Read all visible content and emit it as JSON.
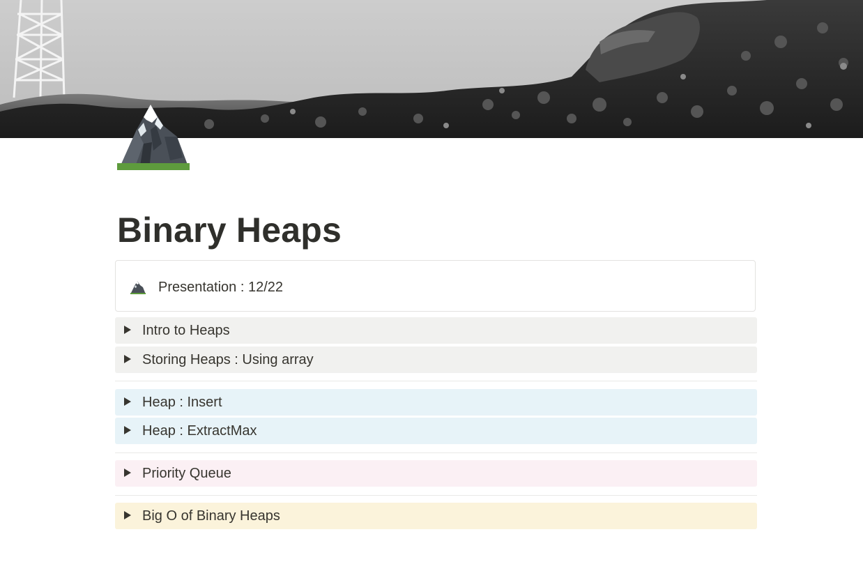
{
  "page": {
    "title": "Binary Heaps",
    "icon": "mountain-icon"
  },
  "callout": {
    "icon": "mountain-icon",
    "text": "Presentation : 12/22"
  },
  "toggles": [
    {
      "label": "Intro to Heaps",
      "color": "#f1f1ef"
    },
    {
      "label": "Storing Heaps : Using array",
      "color": "#f1f1ef"
    },
    {
      "label": "Heap : Insert",
      "color": "#e7f3f8"
    },
    {
      "label": "Heap : ExtractMax",
      "color": "#e7f3f8"
    },
    {
      "label": "Priority Queue",
      "color": "#fbf0f4"
    },
    {
      "label": "Big O of Binary Heaps",
      "color": "#fbf3db"
    }
  ],
  "colors": {
    "gray_block": "#f1f1ef",
    "blue_block": "#e7f3f8",
    "pink_block": "#fbf0f4",
    "yellow_block": "#fbf3db",
    "text": "#37352f"
  }
}
